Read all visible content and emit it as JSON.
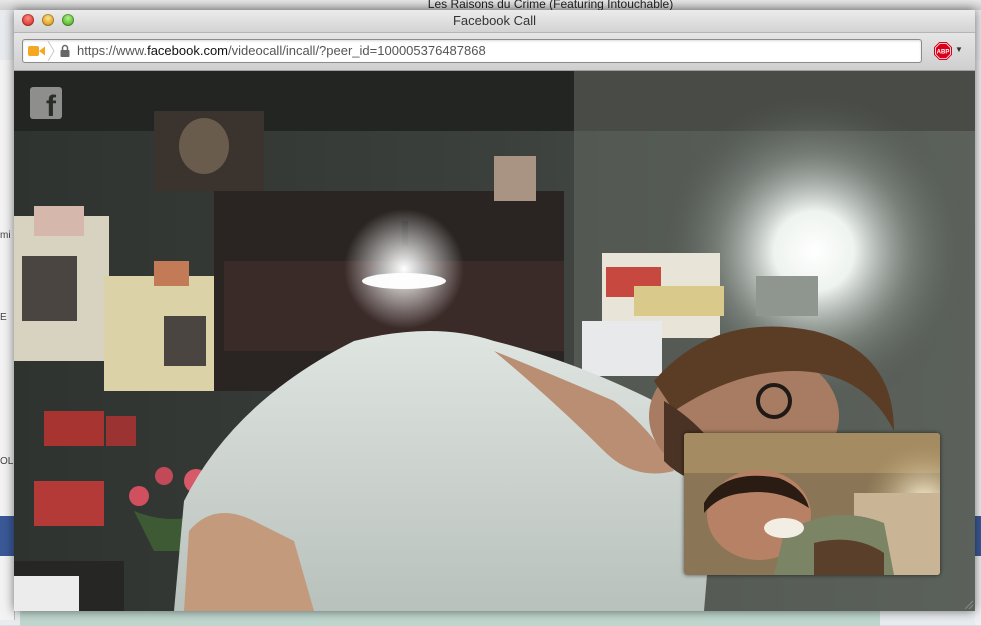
{
  "background": {
    "window_title": "Les Raisons du Crime (Featuring Intouchable)",
    "left_fragments": [
      "mi",
      "E",
      "OLI"
    ]
  },
  "window": {
    "title": "Facebook Call"
  },
  "toolbar": {
    "url": {
      "prefix": "https://www.",
      "domain": "facebook.com",
      "path": "/videocall/incall/?peer_id=100005376487868"
    },
    "adblock_label": "ABP"
  },
  "video": {
    "logo_letter": "f"
  },
  "colors": {
    "facebook_blue": "#3b5998",
    "camera_orange": "#f5a623",
    "abp_red": "#d8001b"
  }
}
